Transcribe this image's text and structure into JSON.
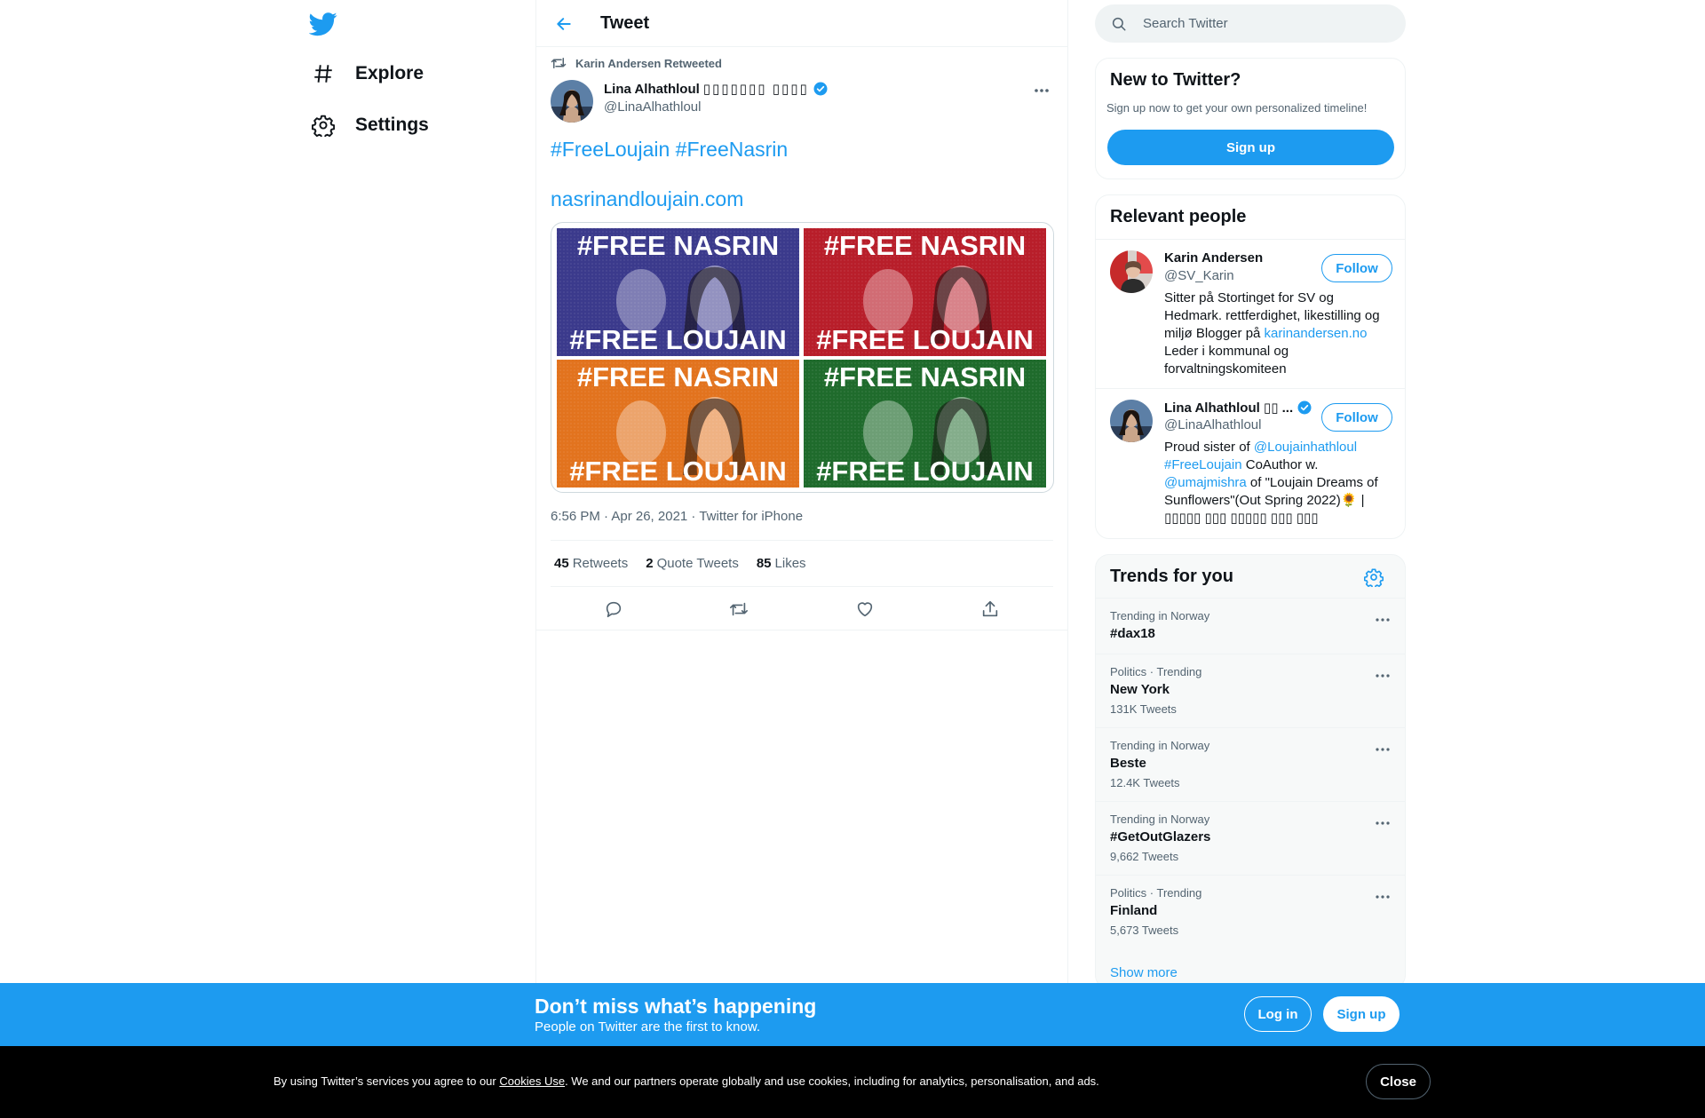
{
  "nav": {
    "logo_icon": "twitter-bird-icon",
    "items": [
      {
        "label": "Explore",
        "icon": "hashtag-icon"
      },
      {
        "label": "Settings",
        "icon": "gear-icon"
      }
    ]
  },
  "header": {
    "title": "Tweet",
    "back_icon": "arrow-left-icon"
  },
  "tweet": {
    "retweeted_by": "Karin Andersen Retweeted",
    "author_name": "Lina Alhathloul",
    "author_name_suffix": "▯▯▯▯▯▯▯ ▯▯▯▯",
    "author_handle": "@LinaAlhathloul",
    "text_line1": "#FreeLoujain #FreeNasrin",
    "text_line2": "nasrinandloujain.com",
    "media_tiles": [
      {
        "top": "#FREE NASRIN",
        "bottom": "#FREE LOUJAIN",
        "color": "#3b3a8c"
      },
      {
        "top": "#FREE NASRIN",
        "bottom": "#FREE LOUJAIN",
        "color": "#b81e2a"
      },
      {
        "top": "#FREE NASRIN",
        "bottom": "#FREE LOUJAIN",
        "color": "#e2731e"
      },
      {
        "top": "#FREE NASRIN",
        "bottom": "#FREE LOUJAIN",
        "color": "#1f6b2c"
      }
    ],
    "meta": "6:56 PM · Apr 26, 2021 · Twitter for iPhone",
    "stats": {
      "retweets_count": "45",
      "retweets_label": "Retweets",
      "quotes_count": "2",
      "quotes_label": "Quote Tweets",
      "likes_count": "85",
      "likes_label": "Likes"
    }
  },
  "search": {
    "placeholder": "Search Twitter"
  },
  "new_to_twitter": {
    "title": "New to Twitter?",
    "subtitle": "Sign up now to get your own personalized timeline!",
    "button": "Sign up"
  },
  "relevant_people": {
    "title": "Relevant people",
    "people": [
      {
        "name": "Karin Andersen",
        "handle": "@SV_Karin",
        "follow": "Follow",
        "bio_pre": "Sitter på Stortinget for SV og Hedmark. rettferdighet, likestilling og miljø Blogger på ",
        "bio_link": "karinandersen.no",
        "bio_post": " Leder i kommunal og forvaltningskomiteen"
      },
      {
        "name": "Lina Alhathloul ▯▯ ...",
        "handle": "@LinaAlhathloul",
        "follow": "Follow",
        "bio_pre": "Proud sister of ",
        "bio_link1": "@Loujainhathloul",
        "bio_link2": "#FreeLoujain",
        "bio_mid": " CoAuthor w. ",
        "bio_link3": "@umajmishra",
        "bio_post": " of \"Loujain Dreams of Sunflowers\"(Out Spring 2022)🌻 | ▯▯▯▯▯ ▯▯▯ ▯▯▯▯▯ ▯▯▯ ▯▯▯"
      }
    ]
  },
  "trends": {
    "title": "Trends for you",
    "items": [
      {
        "context": "Trending in Norway",
        "name": "#dax18",
        "count": ""
      },
      {
        "context": "Politics · Trending",
        "name": "New York",
        "count": "131K Tweets"
      },
      {
        "context": "Trending in Norway",
        "name": "Beste",
        "count": "12.4K Tweets"
      },
      {
        "context": "Trending in Norway",
        "name": "#GetOutGlazers",
        "count": "9,662 Tweets"
      },
      {
        "context": "Politics · Trending",
        "name": "Finland",
        "count": "5,673 Tweets"
      }
    ],
    "show_more": "Show more"
  },
  "bottom_bar": {
    "title": "Don’t miss what’s happening",
    "subtitle": "People on Twitter are the first to know.",
    "login": "Log in",
    "signup": "Sign up"
  },
  "cookie": {
    "pre": "By using Twitter’s services you agree to our ",
    "link": "Cookies Use",
    "post": ". We and our partners operate globally and use cookies, including for analytics, personalisation, and ads.",
    "close": "Close"
  },
  "colors": {
    "accent": "#1d9bf0",
    "text": "#0f1419",
    "secondary": "#536471",
    "border": "#eff3f4"
  }
}
